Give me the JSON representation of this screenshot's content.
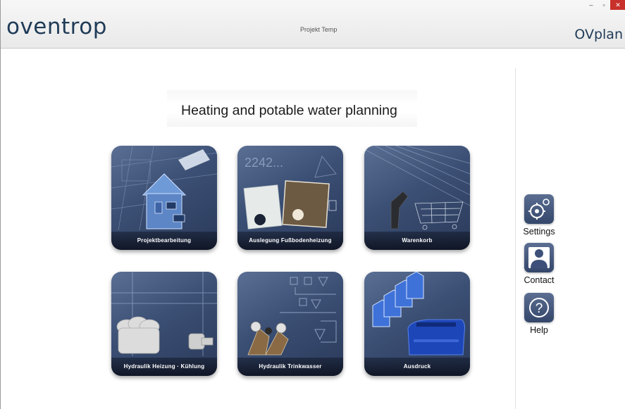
{
  "window": {
    "brand": "oventrop",
    "project": "Projekt Temp",
    "app_name": "OVplan",
    "controls": {
      "minimize": "–",
      "maximize": "▫",
      "close": "✕"
    }
  },
  "main": {
    "headline": "Heating and potable water planning",
    "tiles": [
      {
        "label": "Projektbearbeitung",
        "icon": "house-plan-image"
      },
      {
        "label": "Auslegung Fußbodenheizung",
        "icon": "floor-heating-image"
      },
      {
        "label": "Warenkorb",
        "icon": "shopping-cart-image"
      },
      {
        "label": "Hydraulik Heizung · Kühlung",
        "icon": "radiator-valve-image"
      },
      {
        "label": "Hydraulik Trinkwasser",
        "icon": "water-valves-image"
      },
      {
        "label": "Ausdruck",
        "icon": "printer-image"
      }
    ]
  },
  "sidebar": {
    "items": [
      {
        "label": "Settings",
        "icon": "gear-icon"
      },
      {
        "label": "Contact",
        "icon": "person-icon"
      },
      {
        "label": "Help",
        "icon": "question-icon"
      }
    ]
  },
  "colors": {
    "brand": "#1f3b57",
    "tile": "#3b4f74",
    "close": "#c8302b"
  }
}
